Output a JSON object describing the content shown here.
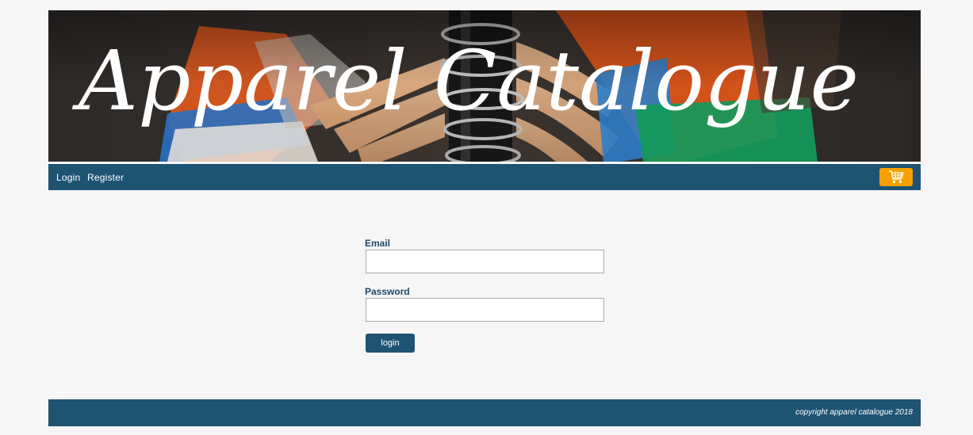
{
  "banner": {
    "title": "Apparel Catalogue"
  },
  "nav": {
    "login_label": "Login",
    "register_label": "Register",
    "cart_icon": "shopping-cart-icon"
  },
  "form": {
    "email_label": "Email",
    "email_value": "",
    "password_label": "Password",
    "password_value": "",
    "submit_label": "login"
  },
  "footer": {
    "copyright": "copyright apparel catalogue 2018"
  },
  "colors": {
    "primary": "#1f5372",
    "accent": "#f5a000",
    "background": "#f6f6f6",
    "label": "#1f4a6a"
  }
}
